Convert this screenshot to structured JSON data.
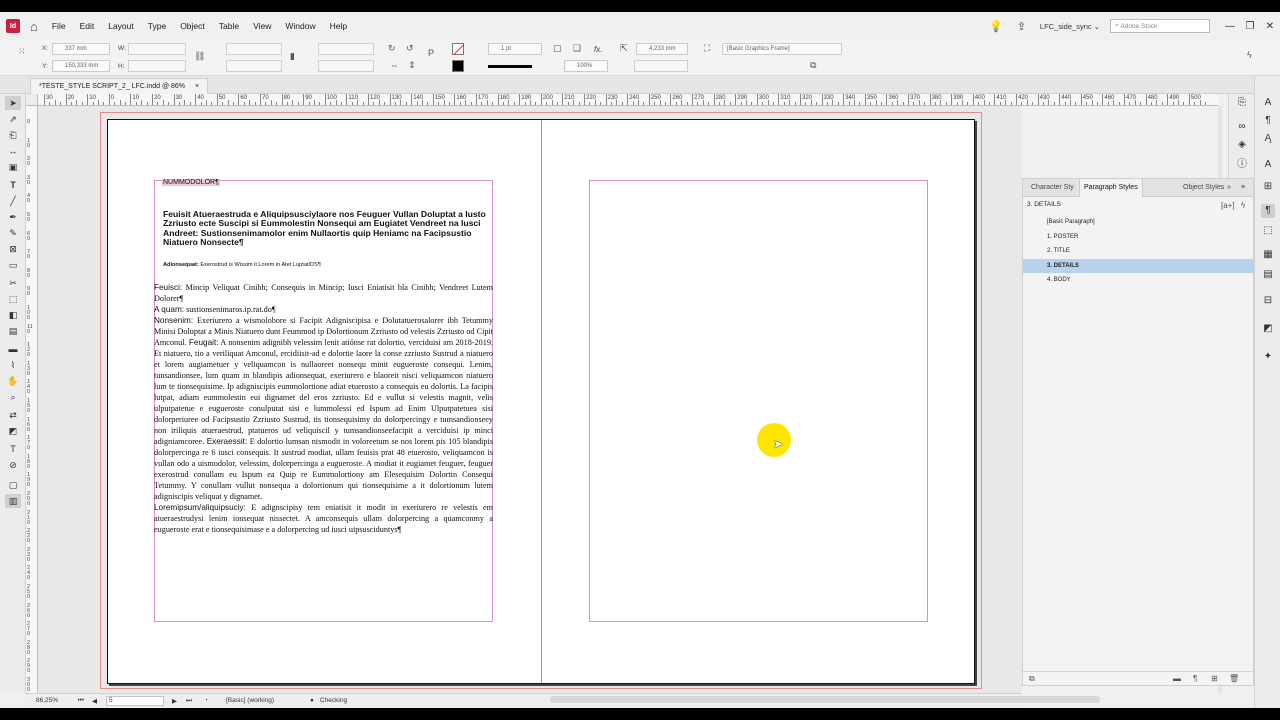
{
  "app": {
    "logo_text": "Id"
  },
  "menu": [
    "File",
    "Edit",
    "Layout",
    "Type",
    "Object",
    "Table",
    "View",
    "Window",
    "Help"
  ],
  "topbar": {
    "workspace": "LFC_side_sync",
    "stock_placeholder": "Adobe Stock"
  },
  "control": {
    "x_value": "337 mm",
    "y_value": "150,333 mm",
    "x_label": "X:",
    "y_label": "Y:",
    "w_label": "W:",
    "h_label": "H:",
    "stroke_weight": "1 pt",
    "fx_label": "fx.",
    "width_value": "4,233 mm",
    "zoom_value": "100%",
    "object_style": "[Basic Graphics Frame]"
  },
  "document": {
    "tab_title": "*TESTE_STYLE SCRIPT_2_ LFC.indd @ 86%",
    "close_glyph": "×"
  },
  "ruler": {
    "h_labels": [
      "30",
      "20",
      "10",
      "0",
      "10",
      "20",
      "30",
      "40",
      "50",
      "60",
      "70",
      "80",
      "90",
      "100",
      "110",
      "120",
      "130",
      "140",
      "150",
      "160",
      "170",
      "180",
      "190",
      "200",
      "210",
      "220",
      "230",
      "240",
      "250",
      "260",
      "270",
      "280",
      "290",
      "300",
      "310",
      "320",
      "330",
      "340",
      "350",
      "360",
      "370",
      "380",
      "390",
      "400",
      "410",
      "420",
      "430",
      "440",
      "450",
      "460",
      "470",
      "480",
      "490",
      "500"
    ],
    "v_labels": [
      "0",
      "10",
      "20",
      "30",
      "40",
      "50",
      "60",
      "70",
      "80",
      "90",
      "100",
      "110",
      "120",
      "130",
      "140",
      "150",
      "160",
      "170",
      "180",
      "190",
      "200",
      "210",
      "220",
      "230",
      "240",
      "250",
      "260",
      "270",
      "280",
      "290",
      "300"
    ]
  },
  "page": {
    "poster": "NUMMODOLOR¶",
    "title": "Feuisit Atueraestruda e Aliquipsusciylaore nos Feuguer Vullan Doluptat a Iusto Zzriusto ecte Suscipi si Eummolestin Nonsequi am Eugiatet Vendreet na Iusci Andreet: Sustionsenimamolor enim Nullaortis quip Heniamc na Facipsustio Niatuero Nonsecte¶",
    "details_label": "Adionsequat:",
    "details_text": "Exerostrud is Wissim it Lorem in Atet Luptat/DS¶",
    "body": [
      {
        "label": "Feuisci:",
        "text": " Mincip Veliquat Cinibh; Consequis in Mincip; Iusci Eniatisit bla Cinibh; Vendreet Lutem Dolorer¶"
      },
      {
        "label": "A quam:",
        "text": " sustionsenimaros.ip.rat.do¶"
      },
      {
        "label": "Nonsenim:",
        "text": " Exeriurero a wismolobore si Facipit Adigniscipisa e Dolutatuerosalorer ibh Tetummy Minisi Doluptat a Minis Niatuero dunt Feummod ip Dolortionum Zzriusto od velestis Zzriusto od Cipit Amconul. "
      },
      {
        "label": "Feugait:",
        "text": " A nonsenim adignibh velessim lenit atiónse rat dolortio, verciduisi am 2018-2019. Et niatuero, tio a veriliquat Amconul, ercidiisit-ad e dolortie laore la conse zzriusto Sustrud a niatuero et lorem augiametuer y veliquamcon is nullaoreet nonsequ minit eugueroste consequi. Lenim, tunsandionsee, lum quam in blandipis adionsequat, exeriurero e blaoreit nisci veliquamcon niatuero lum te tionsequisime. Ip adigniscipis eummolortione adiat etuerosto a consequis eu dolortis. La facipis lutpat, adiam eummolestin eui dignamet del eros zzriusto. Ed e vullut si velestis magnit, velis ulputpatetue e eugueroste conulputat sisi e lummolessi ed Ispum ad Enim Ulputpatetuea sisi dolorperiuree od Facipsustio Zzriusto Sustrud, tis tionsequisimy do dolorpercingy e tumsandionseey non iriliquis atueraestrud, ptatueros ud veliquiscil y tumsandionseefacipit a verciduisi ip minci adigniamcoree. "
      },
      {
        "label": "Exeraessit:",
        "text": " E dolortio lumsan nismodit in voloreetum se nos lorem pis 105 blandipis dolorpercinga re 6 iusci consequis. It sustrud modiat, ullam feuisis prat 48 etuerosto, veliquamcon is vullan odo a uismodolor, velessim, dolorpercinga a eugueroste. A modiat it eugiamet feuguer, feuguer exerostrud conullam eu Ispum ea Quip re Eummolortiony am Elesequisim Dolortin Consequi Tetummy. Y conullam vullut nonsequa a dolortionum qui tionsequisime a it dolortionum lutem adigniscipis veliquat y dignamet. "
      },
      {
        "label": "Loremipsum/aliquipsuciy:",
        "text": " E adignscipisy tem eniatisit it modit in exeriurero re velestis em atueraestrudysi lenim ionsequat nissectet. A amconsequis ullam dolorpercing a quamconmy a eugueroste erat e tionsequisimase e a dolorpercing ud iusci uipsusciduntys¶"
      }
    ]
  },
  "status": {
    "zoom": "86,25%",
    "page": "5",
    "style": "[Basic] (working)",
    "preflight": "Checking"
  },
  "panel": {
    "tabs": [
      "Character Sty",
      "Paragraph Styles",
      "Object Styles"
    ],
    "current_style": "3. DETAILS",
    "styles": [
      {
        "name": "[Basic Paragraph]",
        "selected": false
      },
      {
        "name": "1. POSTER",
        "selected": false
      },
      {
        "name": "2. TITLE",
        "selected": false
      },
      {
        "name": "3. DETAILS",
        "selected": true
      },
      {
        "name": "4. BODY",
        "selected": false
      }
    ]
  },
  "colors": {
    "accent_selected": "#b8d1ee",
    "bleed": "#e48a8a",
    "margin": "#d68fc9",
    "cursor_highlight": "#ffe600"
  }
}
